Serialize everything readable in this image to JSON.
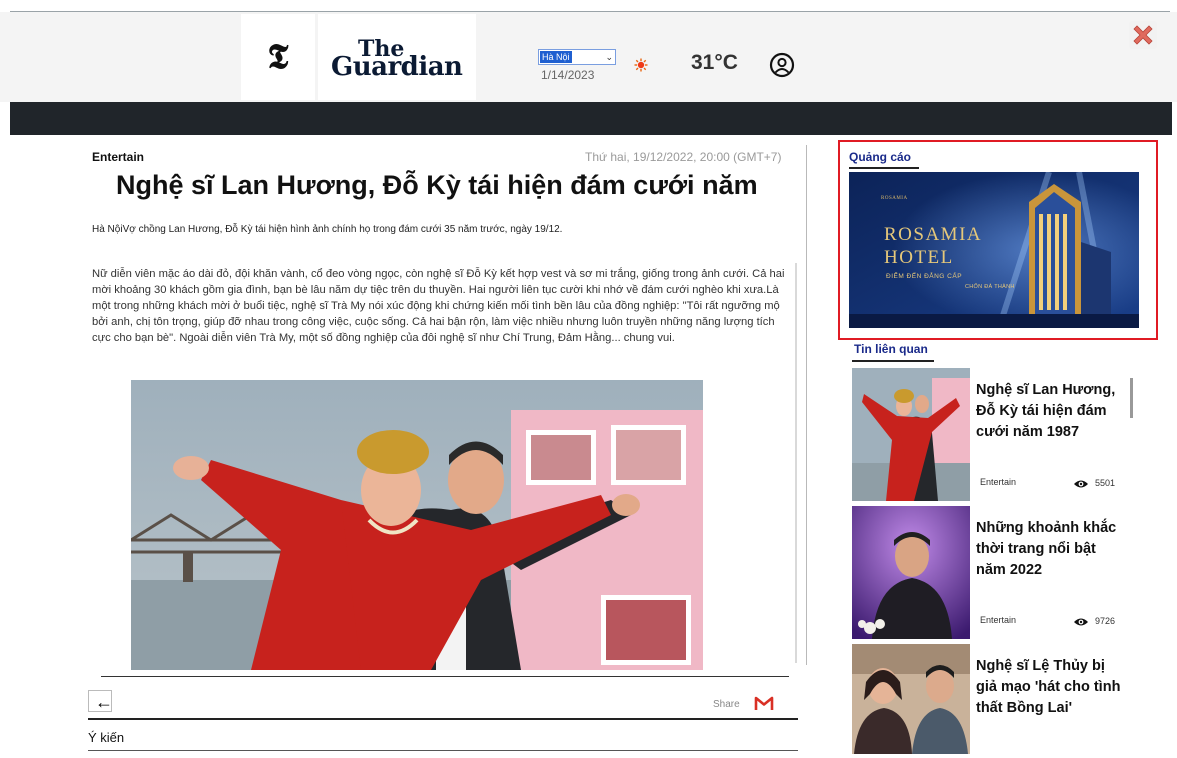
{
  "header": {
    "logo_t": "𝕿",
    "logo_line1": "The",
    "logo_line2": "Guardian",
    "city_selected": "Hà Nội",
    "date": "1/14/2023",
    "temperature": "31°C",
    "icons": [
      "sun-icon",
      "user-icon",
      "close-icon"
    ]
  },
  "article": {
    "category": "Entertain",
    "timestamp": "Thứ hai, 19/12/2022, 20:00 (GMT+7)",
    "headline": "Nghệ sĩ Lan Hương, Đỗ Kỳ tái hiện đám cưới năm",
    "sapo": "Hà NộiVợ chồng Lan Hương, Đỗ Kỳ tái hiện hình ảnh chính họ trong đám cưới 35 năm trước, ngày 19/12.",
    "body": "Nữ diễn viên mặc áo dài đỏ, đội khăn vành, cổ đeo vòng ngọc, còn nghệ sĩ Đỗ Kỳ kết hợp vest và sơ mi trắng, giống trong ảnh cưới. Cả hai mời khoảng 30 khách gồm gia đình, bạn bè lâu năm dự tiệc trên du thuyền. Hai người liên tục cười khi nhớ về đám cưới nghèo khi xưa.Là một trong những khách mời ở buổi tiệc, nghệ sĩ Trà My nói xúc động khi chứng kiến mối tình bền lâu của đồng nghiệp: \"Tôi rất ngưỡng mộ bởi anh, chị tôn trọng, giúp đỡ nhau trong công việc, cuộc sống. Cả hai bận rộn, làm việc nhiều nhưng luôn truyền những năng lượng tích cực cho bạn bè\". Ngoài diễn viên Trà My, một số đồng nghiệp của đôi nghệ sĩ như Chí Trung, Đảm Hằng... chung vui.",
    "back_glyph": "←",
    "share_label": "Share",
    "gmail_letter": "M",
    "comment_label": "Ý kiến"
  },
  "sidebar": {
    "ad_label": "Quảng cáo",
    "ad": {
      "brand_small": "ROSAMIA",
      "title_line1": "ROSAMIA",
      "title_line2": "HOTEL",
      "tagline_line1": "ĐIỂM ĐẾN ĐẲNG CẤP",
      "tagline_line2": "CHỐN ĐÀ THÀNH"
    },
    "related_label": "Tin liên quan",
    "related": [
      {
        "title": "Nghệ sĩ Lan Hương, Đỗ Kỳ tái hiện đám cưới năm 1987",
        "category": "Entertain",
        "views": "5501"
      },
      {
        "title": "Những khoảnh khắc thời trang nổi bật năm 2022",
        "category": "Entertain",
        "views": "9726"
      },
      {
        "title": "Nghệ sĩ Lệ Thủy bị giả mạo 'hát cho tình thất Bồng Lai'",
        "category": "",
        "views": ""
      }
    ]
  },
  "colors": {
    "navbar": "#20252a",
    "ad_border": "#e01b24",
    "label_blue": "#1a2a8a",
    "gmail_red": "#d93025"
  }
}
